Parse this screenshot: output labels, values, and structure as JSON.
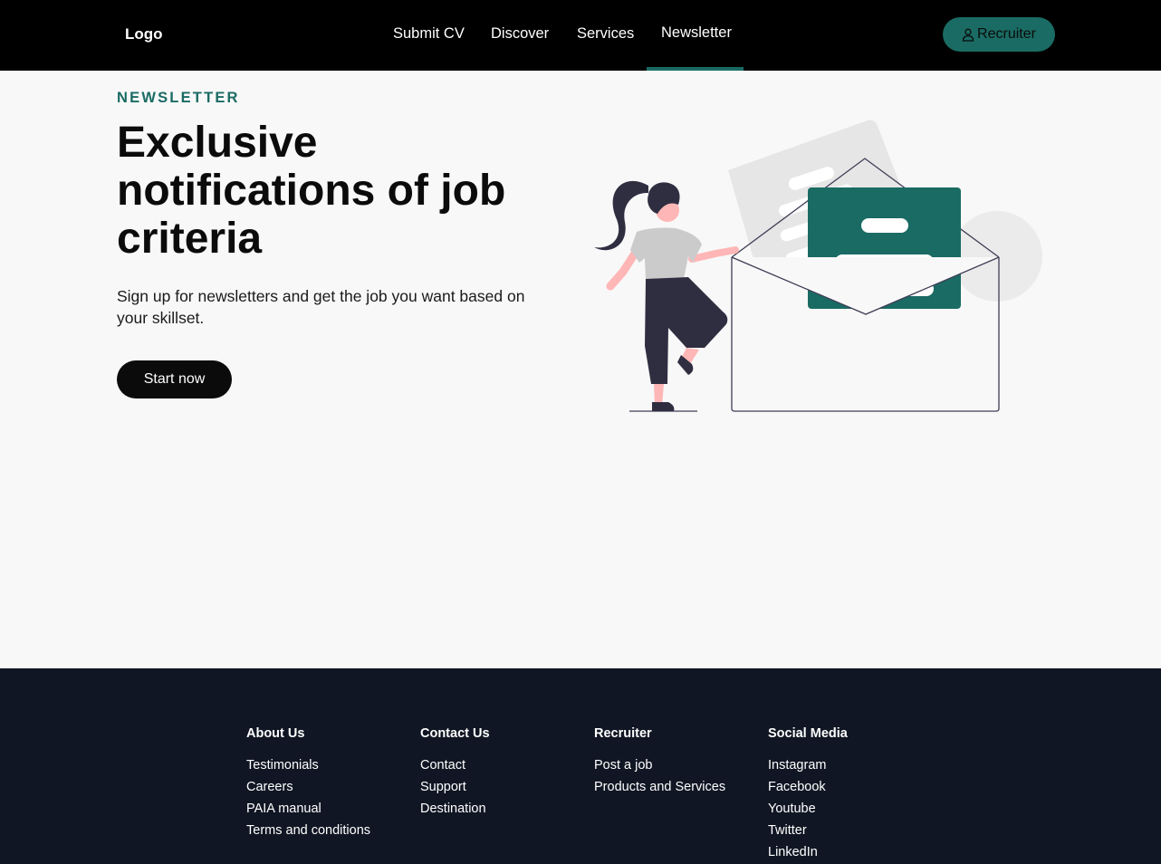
{
  "header": {
    "logo": "Logo",
    "nav": [
      {
        "label": "Submit CV"
      },
      {
        "label": "Discover"
      },
      {
        "label": "Services"
      },
      {
        "label": "Newsletter",
        "active": true
      }
    ],
    "recruiter_button": {
      "label": "Recruiter",
      "icon": "user-icon"
    }
  },
  "hero": {
    "eyebrow": "NEWSLETTER",
    "title": "Exclusive notifications of job criteria",
    "subtitle": "Sign up for newsletters and get the job you want based on your skillset.",
    "cta": "Start now"
  },
  "footer": {
    "columns": [
      {
        "heading": "About Us",
        "links": [
          "Testimonials",
          "Careers",
          "PAIA manual",
          "Terms and conditions"
        ]
      },
      {
        "heading": "Contact Us",
        "links": [
          "Contact",
          "Support",
          "Destination"
        ]
      },
      {
        "heading": "Recruiter",
        "links": [
          "Post a job",
          "Products and Services"
        ]
      },
      {
        "heading": "Social Media",
        "links": [
          "Instagram",
          "Facebook",
          "Youtube",
          "Twitter",
          "LinkedIn"
        ]
      }
    ]
  },
  "colors": {
    "accent": "#1a6b63",
    "header_bg": "#000000",
    "footer_bg": "#101623",
    "page_bg": "#f8f8f8"
  }
}
